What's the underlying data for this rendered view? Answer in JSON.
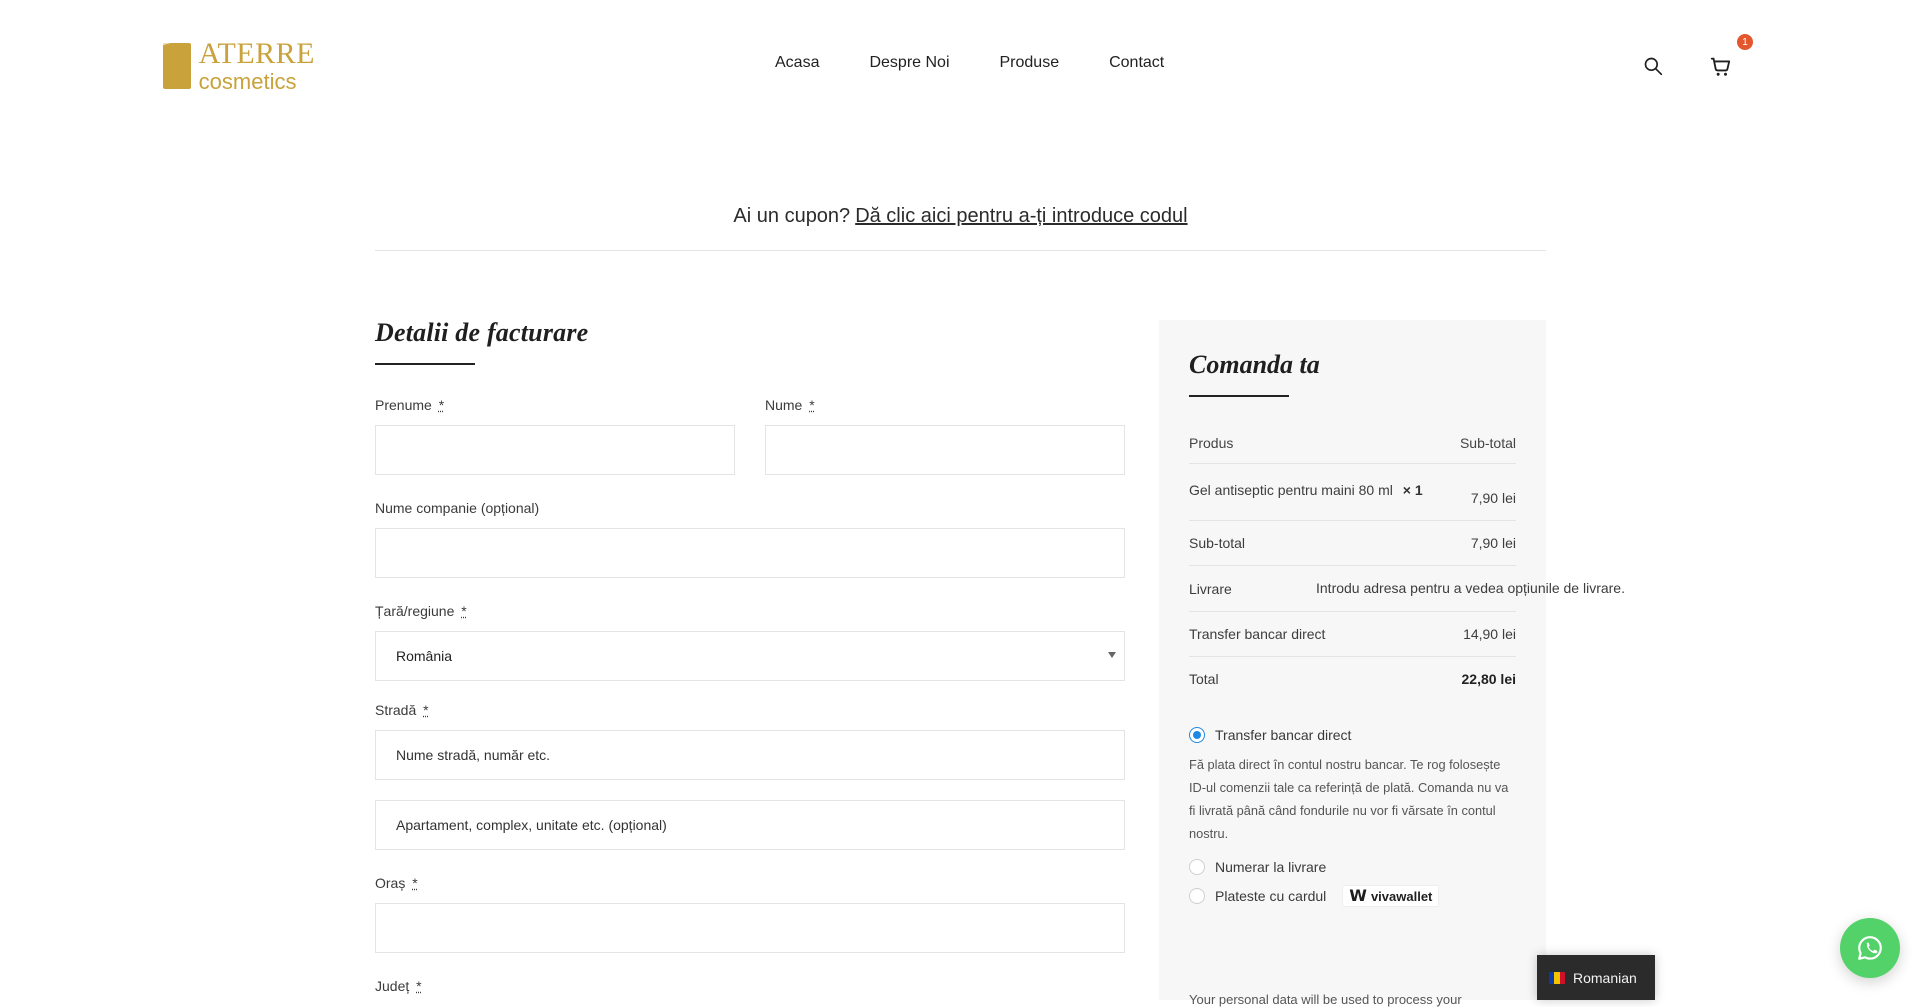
{
  "header": {
    "logo": {
      "line1": "ATERRE",
      "line2": "cosmetics"
    },
    "nav": [
      "Acasa",
      "Despre Noi",
      "Produse",
      "Contact"
    ],
    "icons": {
      "search": "search-icon",
      "cart": "cart-icon"
    },
    "cart_count": "1",
    "colors": {
      "brand": "#c9a23b",
      "badge": "#e4572e"
    }
  },
  "coupon": {
    "prefix": "Ai un cupon?",
    "link": "Dă clic aici pentru a-ți introduce codul"
  },
  "billing": {
    "title": "Detalii de facturare",
    "fields": {
      "first_name_label": "Prenume",
      "last_name_label": "Nume",
      "company_label": "Nume companie (opțional)",
      "country_label": "Țară/regiune",
      "country_value": "România",
      "street_label": "Stradă",
      "street_placeholder_1": "Nume stradă, număr etc.",
      "street_placeholder_2": "Apartament, complex, unitate etc. (opțional)",
      "city_label": "Oraș",
      "county_label": "Județ"
    },
    "required_mark": "*"
  },
  "order": {
    "title": "Comanda ta",
    "table": {
      "head_left": "Produs",
      "head_right": "Sub-total",
      "item_name": "Gel antiseptic pentru maini 80 ml",
      "item_qty": "× 1",
      "item_total": "7,90 lei",
      "subtotal_label": "Sub-total",
      "subtotal_value": "7,90 lei",
      "shipping_label": "Livrare",
      "shipping_value": "Introdu adresa pentru a vedea opțiunile de livrare.",
      "fee_label": "Transfer bancar direct",
      "fee_value": "14,90 lei",
      "total_label": "Total",
      "total_value": "22,80 lei"
    },
    "payment": {
      "selected": "Transfer bancar direct",
      "description": "Fă plata direct în contul nostru bancar. Te rog folosește ID-ul comenzii tale ca referință de plată. Comanda nu va fi livrată până când fondurile nu vor fi vărsate în contul nostru.",
      "option_cod": "Numerar la livrare",
      "option_card": "Plateste cu cardul",
      "card_brand": "vivawallet"
    },
    "personal_data_partial": "Your personal data will be used to process your"
  },
  "language": {
    "label": "Romanian"
  },
  "whatsapp": {
    "icon": "whatsapp-icon",
    "color": "#54d26a"
  }
}
